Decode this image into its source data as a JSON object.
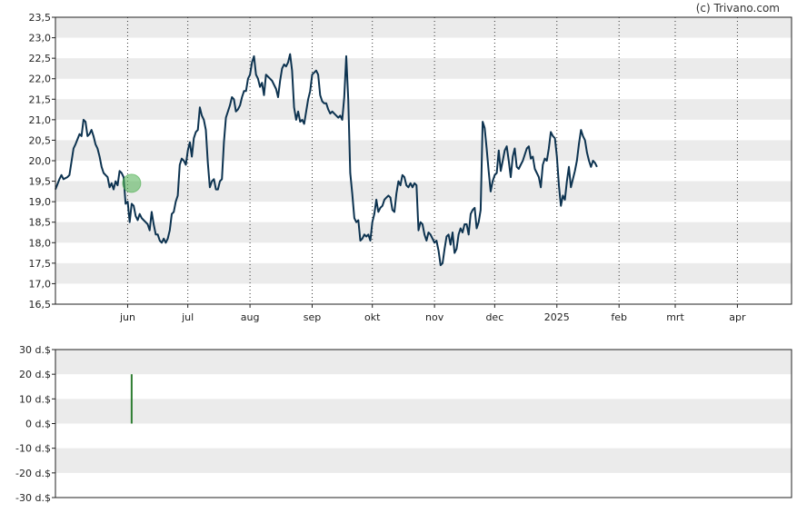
{
  "credit": "(c) Trivano.com",
  "chart_data": [
    {
      "type": "line",
      "title": "",
      "xlabel": "",
      "ylabel": "",
      "ylim": [
        16.5,
        23.5
      ],
      "yticks": [
        "16,5",
        "17,0",
        "17,5",
        "18,0",
        "18,5",
        "19,0",
        "19,5",
        "20,0",
        "20,5",
        "21,0",
        "21,5",
        "22,0",
        "22,5",
        "23,0",
        "23,5"
      ],
      "grid": "horizontal bands, vertical dotted month lines",
      "months": [
        {
          "label": "jun",
          "day": 36
        },
        {
          "label": "jul",
          "day": 66
        },
        {
          "label": "aug",
          "day": 97
        },
        {
          "label": "sep",
          "day": 128
        },
        {
          "label": "okt",
          "day": 158
        },
        {
          "label": "nov",
          "day": 189
        },
        {
          "label": "dec",
          "day": 219
        },
        {
          "label": "2025",
          "day": 250
        },
        {
          "label": "feb",
          "day": 281
        },
        {
          "label": "mrt",
          "day": 309
        },
        {
          "label": "apr",
          "day": 340
        }
      ],
      "x_range_days": [
        0,
        367
      ],
      "line_color": "#0d3350",
      "marker": {
        "day": 38,
        "value": 19.45,
        "color": "#4caf50"
      },
      "series": [
        {
          "values": [
            [
              0,
              19.3
            ],
            [
              2,
              19.55
            ],
            [
              3,
              19.65
            ],
            [
              4,
              19.55
            ],
            [
              6,
              19.6
            ],
            [
              7,
              19.65
            ],
            [
              9,
              20.3
            ],
            [
              10,
              20.4
            ],
            [
              12,
              20.65
            ],
            [
              13,
              20.6
            ],
            [
              14,
              21.0
            ],
            [
              15,
              20.95
            ],
            [
              16,
              20.6
            ],
            [
              17,
              20.65
            ],
            [
              18,
              20.75
            ],
            [
              19,
              20.6
            ],
            [
              20,
              20.4
            ],
            [
              21,
              20.3
            ],
            [
              22,
              20.1
            ],
            [
              23,
              19.85
            ],
            [
              24,
              19.7
            ],
            [
              25,
              19.65
            ],
            [
              26,
              19.6
            ],
            [
              27,
              19.35
            ],
            [
              28,
              19.45
            ],
            [
              29,
              19.3
            ],
            [
              30,
              19.5
            ],
            [
              31,
              19.4
            ],
            [
              32,
              19.75
            ],
            [
              33,
              19.7
            ],
            [
              34,
              19.6
            ],
            [
              35,
              18.95
            ],
            [
              36,
              19.0
            ],
            [
              37,
              18.5
            ],
            [
              38,
              18.95
            ],
            [
              39,
              18.9
            ],
            [
              40,
              18.65
            ],
            [
              41,
              18.55
            ],
            [
              42,
              18.7
            ],
            [
              43,
              18.6
            ],
            [
              44,
              18.55
            ],
            [
              45,
              18.5
            ],
            [
              46,
              18.45
            ],
            [
              47,
              18.3
            ],
            [
              48,
              18.75
            ],
            [
              49,
              18.45
            ],
            [
              50,
              18.2
            ],
            [
              51,
              18.2
            ],
            [
              52,
              18.05
            ],
            [
              53,
              18.0
            ],
            [
              54,
              18.1
            ],
            [
              55,
              18.0
            ],
            [
              56,
              18.1
            ],
            [
              57,
              18.3
            ],
            [
              58,
              18.7
            ],
            [
              59,
              18.75
            ],
            [
              60,
              19.0
            ],
            [
              61,
              19.15
            ],
            [
              62,
              19.9
            ],
            [
              63,
              20.05
            ],
            [
              64,
              20.0
            ],
            [
              65,
              19.9
            ],
            [
              66,
              20.25
            ],
            [
              67,
              20.45
            ],
            [
              68,
              20.1
            ],
            [
              69,
              20.55
            ],
            [
              70,
              20.7
            ],
            [
              71,
              20.75
            ],
            [
              72,
              21.3
            ],
            [
              73,
              21.1
            ],
            [
              74,
              21.0
            ],
            [
              75,
              20.75
            ],
            [
              76,
              19.95
            ],
            [
              77,
              19.35
            ],
            [
              78,
              19.5
            ],
            [
              79,
              19.55
            ],
            [
              80,
              19.3
            ],
            [
              81,
              19.3
            ],
            [
              82,
              19.5
            ],
            [
              83,
              19.55
            ],
            [
              84,
              20.45
            ],
            [
              85,
              21.05
            ],
            [
              86,
              21.2
            ],
            [
              87,
              21.35
            ],
            [
              88,
              21.55
            ],
            [
              89,
              21.5
            ],
            [
              90,
              21.2
            ],
            [
              91,
              21.25
            ],
            [
              92,
              21.35
            ],
            [
              93,
              21.55
            ],
            [
              94,
              21.7
            ],
            [
              95,
              21.7
            ],
            [
              96,
              22.0
            ],
            [
              97,
              22.1
            ],
            [
              98,
              22.4
            ],
            [
              99,
              22.55
            ],
            [
              100,
              22.1
            ],
            [
              101,
              22.0
            ],
            [
              102,
              21.8
            ],
            [
              103,
              21.9
            ],
            [
              104,
              21.6
            ],
            [
              105,
              22.1
            ],
            [
              106,
              22.05
            ],
            [
              107,
              22.0
            ],
            [
              108,
              21.95
            ],
            [
              109,
              21.85
            ],
            [
              110,
              21.75
            ],
            [
              111,
              21.55
            ],
            [
              112,
              21.95
            ],
            [
              113,
              22.25
            ],
            [
              114,
              22.35
            ],
            [
              115,
              22.3
            ],
            [
              116,
              22.4
            ],
            [
              117,
              22.6
            ],
            [
              118,
              22.2
            ],
            [
              119,
              21.3
            ],
            [
              120,
              21.0
            ],
            [
              121,
              21.2
            ],
            [
              122,
              20.95
            ],
            [
              123,
              21.0
            ],
            [
              124,
              20.9
            ],
            [
              125,
              21.2
            ],
            [
              126,
              21.5
            ],
            [
              127,
              21.7
            ],
            [
              128,
              22.1
            ],
            [
              129,
              22.15
            ],
            [
              130,
              22.2
            ],
            [
              131,
              22.1
            ],
            [
              132,
              21.6
            ],
            [
              133,
              21.45
            ],
            [
              134,
              21.4
            ],
            [
              135,
              21.4
            ],
            [
              136,
              21.25
            ],
            [
              137,
              21.15
            ],
            [
              138,
              21.2
            ],
            [
              139,
              21.15
            ],
            [
              140,
              21.1
            ],
            [
              141,
              21.05
            ],
            [
              142,
              21.1
            ],
            [
              143,
              21.0
            ],
            [
              144,
              21.55
            ],
            [
              145,
              22.55
            ],
            [
              146,
              21.5
            ],
            [
              147,
              19.7
            ],
            [
              148,
              19.2
            ],
            [
              149,
              18.6
            ],
            [
              150,
              18.5
            ],
            [
              151,
              18.55
            ],
            [
              152,
              18.05
            ],
            [
              153,
              18.1
            ],
            [
              154,
              18.2
            ],
            [
              155,
              18.15
            ],
            [
              156,
              18.2
            ],
            [
              157,
              18.05
            ],
            [
              158,
              18.5
            ],
            [
              159,
              18.7
            ],
            [
              160,
              19.05
            ],
            [
              161,
              18.75
            ],
            [
              162,
              18.85
            ],
            [
              163,
              18.9
            ],
            [
              164,
              19.05
            ],
            [
              165,
              19.1
            ],
            [
              166,
              19.15
            ],
            [
              167,
              19.1
            ],
            [
              168,
              18.8
            ],
            [
              169,
              18.75
            ],
            [
              170,
              19.2
            ],
            [
              171,
              19.5
            ],
            [
              172,
              19.4
            ],
            [
              173,
              19.65
            ],
            [
              174,
              19.6
            ],
            [
              175,
              19.4
            ],
            [
              176,
              19.35
            ],
            [
              177,
              19.45
            ],
            [
              178,
              19.35
            ],
            [
              179,
              19.45
            ],
            [
              180,
              19.4
            ],
            [
              181,
              18.3
            ],
            [
              182,
              18.5
            ],
            [
              183,
              18.45
            ],
            [
              184,
              18.2
            ],
            [
              185,
              18.05
            ],
            [
              186,
              18.25
            ],
            [
              187,
              18.2
            ],
            [
              188,
              18.1
            ],
            [
              189,
              18.0
            ],
            [
              190,
              18.05
            ],
            [
              191,
              17.8
            ],
            [
              192,
              17.45
            ],
            [
              193,
              17.5
            ],
            [
              194,
              17.85
            ],
            [
              195,
              18.15
            ],
            [
              196,
              18.2
            ],
            [
              197,
              17.95
            ],
            [
              198,
              18.25
            ],
            [
              199,
              17.75
            ],
            [
              200,
              17.85
            ],
            [
              201,
              18.2
            ],
            [
              202,
              18.35
            ],
            [
              203,
              18.25
            ],
            [
              204,
              18.45
            ],
            [
              205,
              18.45
            ],
            [
              206,
              18.2
            ],
            [
              207,
              18.7
            ],
            [
              208,
              18.8
            ],
            [
              209,
              18.85
            ],
            [
              210,
              18.35
            ],
            [
              211,
              18.5
            ],
            [
              212,
              18.8
            ],
            [
              213,
              20.95
            ],
            [
              214,
              20.8
            ],
            [
              215,
              20.3
            ],
            [
              216,
              19.75
            ],
            [
              217,
              19.25
            ],
            [
              218,
              19.5
            ],
            [
              219,
              19.65
            ],
            [
              220,
              19.7
            ],
            [
              221,
              20.25
            ],
            [
              222,
              19.75
            ],
            [
              223,
              20.0
            ],
            [
              224,
              20.25
            ],
            [
              225,
              20.35
            ],
            [
              226,
              20.0
            ],
            [
              227,
              19.6
            ],
            [
              228,
              20.1
            ],
            [
              229,
              20.3
            ],
            [
              230,
              19.85
            ],
            [
              231,
              19.8
            ],
            [
              232,
              19.9
            ],
            [
              233,
              20.0
            ],
            [
              234,
              20.15
            ],
            [
              235,
              20.3
            ],
            [
              236,
              20.35
            ],
            [
              237,
              20.05
            ],
            [
              238,
              20.1
            ],
            [
              239,
              19.8
            ],
            [
              240,
              19.7
            ],
            [
              241,
              19.6
            ],
            [
              242,
              19.35
            ],
            [
              243,
              19.9
            ],
            [
              244,
              20.05
            ],
            [
              245,
              20.0
            ],
            [
              246,
              20.3
            ],
            [
              247,
              20.7
            ],
            [
              248,
              20.6
            ],
            [
              249,
              20.55
            ],
            [
              250,
              20.1
            ],
            [
              251,
              19.4
            ],
            [
              252,
              18.9
            ],
            [
              253,
              19.15
            ],
            [
              254,
              19.05
            ],
            [
              255,
              19.5
            ],
            [
              256,
              19.85
            ],
            [
              257,
              19.35
            ],
            [
              258,
              19.55
            ],
            [
              259,
              19.75
            ],
            [
              260,
              20.0
            ],
            [
              261,
              20.4
            ],
            [
              262,
              20.75
            ],
            [
              263,
              20.6
            ],
            [
              264,
              20.5
            ],
            [
              265,
              20.2
            ],
            [
              266,
              20.0
            ],
            [
              267,
              19.85
            ],
            [
              268,
              20.0
            ],
            [
              269,
              19.95
            ],
            [
              270,
              19.85
            ]
          ]
        }
      ]
    },
    {
      "type": "bar",
      "title": "",
      "ylim": [
        -30,
        30
      ],
      "yticks": [
        "30 d.$",
        "20 d.$",
        "10 d.$",
        "0 d.$",
        "-10 d.$",
        "-20 d.$",
        "-30 d.$"
      ],
      "bars": [
        {
          "day": 38,
          "value": 20,
          "color": "#2e7d32"
        }
      ]
    }
  ]
}
